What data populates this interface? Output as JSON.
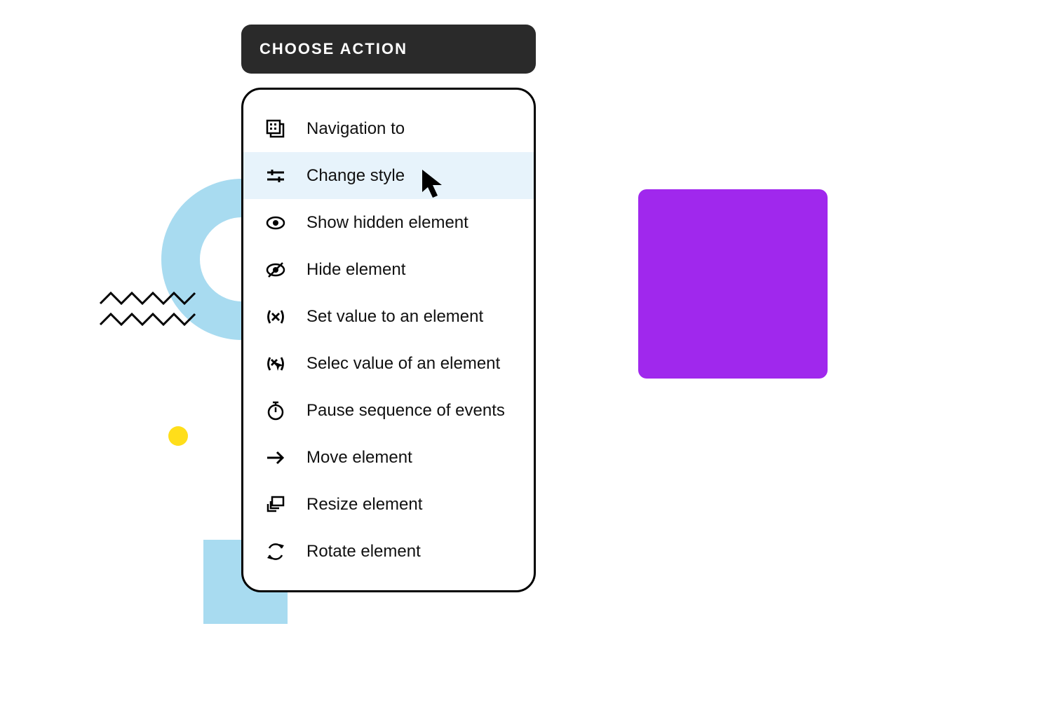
{
  "header": {
    "title": "CHOOSE ACTION"
  },
  "menu": {
    "items": [
      {
        "icon": "navigation-icon",
        "label": "Navigation to"
      },
      {
        "icon": "sliders-icon",
        "label": "Change style",
        "highlighted": true
      },
      {
        "icon": "eye-icon",
        "label": "Show hidden element"
      },
      {
        "icon": "eye-slash-icon",
        "label": "Hide element"
      },
      {
        "icon": "set-value-icon",
        "label": "Set value to an element"
      },
      {
        "icon": "select-value-icon",
        "label": "Selec value of an element"
      },
      {
        "icon": "stopwatch-icon",
        "label": "Pause sequence of events"
      },
      {
        "icon": "arrow-right-icon",
        "label": "Move element"
      },
      {
        "icon": "resize-icon",
        "label": "Resize element"
      },
      {
        "icon": "rotate-icon",
        "label": "Rotate element"
      }
    ]
  },
  "decor": {
    "purple_square_color": "#A028ED",
    "blue_accent_color": "#A8DBF0",
    "yellow_dot_color": "#FFDE1A"
  }
}
